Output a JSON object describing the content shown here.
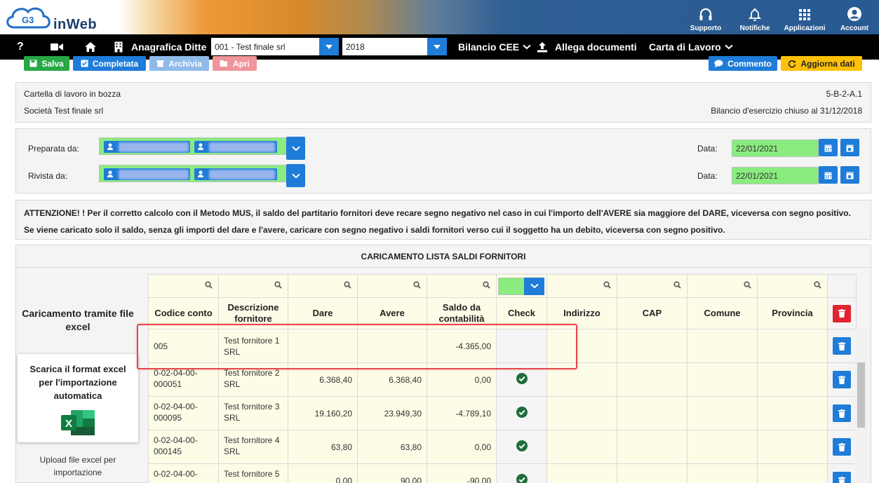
{
  "header": {
    "logo_text": "inWeb",
    "logo_mark": "G3",
    "actions": [
      {
        "label": "Supporto",
        "icon": "headset-icon"
      },
      {
        "label": "Notifiche",
        "icon": "bell-icon"
      },
      {
        "label": "Applicazioni",
        "icon": "grid-icon"
      },
      {
        "label": "Account",
        "icon": "user-circle-icon"
      }
    ]
  },
  "navbar": {
    "help_label": "?",
    "anagrafica_label": "Anagrafica Ditte",
    "company_select": "001 - Test finale srl",
    "year_select": "2018",
    "bilancio_label": "Bilancio CEE",
    "allega_label": "Allega documenti",
    "carta_label": "Carta di Lavoro"
  },
  "toolbar": {
    "salva": "Salva",
    "completata": "Completata",
    "archivia": "Archivia",
    "apri": "Apri",
    "commento": "Commento",
    "aggiorna": "Aggiorna dati"
  },
  "info": {
    "status": "Cartella di lavoro in bozza",
    "code": "5-B-2-A.1",
    "company": "Società Test finale srl",
    "bilancio": "Bilancio d'esercizio chiuso al 31/12/2018"
  },
  "review": {
    "preparata_label": "Preparata da:",
    "rivista_label": "Rivista da:",
    "data_label": "Data:",
    "date1": "22/01/2021",
    "date2": "22/01/2021"
  },
  "warning": {
    "line1": "ATTENZIONE! ! Per il corretto calcolo con il Metodo MUS, il saldo del partitario fornitori deve recare segno negativo nel caso in cui l'importo dell'AVERE sia maggiore del DARE, viceversa con segno positivo.",
    "line2": "Se viene caricato solo il saldo, senza gli importi del dare e l'avere, caricare con segno negativo i saldi fornitori verso cui il soggetto ha un debito, viceversa con segno positivo."
  },
  "section": {
    "title": "CARICAMENTO LISTA SALDI FORNITORI"
  },
  "left_panel": {
    "title": "Caricamento tramite file excel",
    "download_label": "Scarica il format excel per l'importazione automatica",
    "upload_label": "Upload file excel per importazione",
    "excel_icon_letter": "X"
  },
  "table": {
    "headers": [
      "Codice conto",
      "Descrizione fornitore",
      "Dare",
      "Avere",
      "Saldo da contabilità",
      "Check",
      "Indirizzo",
      "CAP",
      "Comune",
      "Provincia"
    ],
    "rows": [
      {
        "codice": "005",
        "descrizione": "Test fornitore 1 SRL",
        "dare": "",
        "avere": "",
        "saldo": "-4.365,00",
        "check": false
      },
      {
        "codice": "0-02-04-00-000051",
        "descrizione": "Test fornitore 2 SRL",
        "dare": "6.368,40",
        "avere": "6.368,40",
        "saldo": "0,00",
        "check": true
      },
      {
        "codice": "0-02-04-00-000095",
        "descrizione": "Test fornitore 3 SRL",
        "dare": "19.160,20",
        "avere": "23.949,30",
        "saldo": "-4.789,10",
        "check": true
      },
      {
        "codice": "0-02-04-00-000145",
        "descrizione": "Test fornitore 4 SRL",
        "dare": "63,80",
        "avere": "63,80",
        "saldo": "0,00",
        "check": true
      },
      {
        "codice": "0-02-04-00-",
        "descrizione": "Test fornitore 5",
        "dare": "0,00",
        "avere": "90,00",
        "saldo": "-90,00",
        "check": true
      }
    ]
  },
  "colors": {
    "blue": "#1f7cd8",
    "green": "#27a745",
    "yellow": "#ffc107",
    "highlight_red": "#e5484d"
  }
}
